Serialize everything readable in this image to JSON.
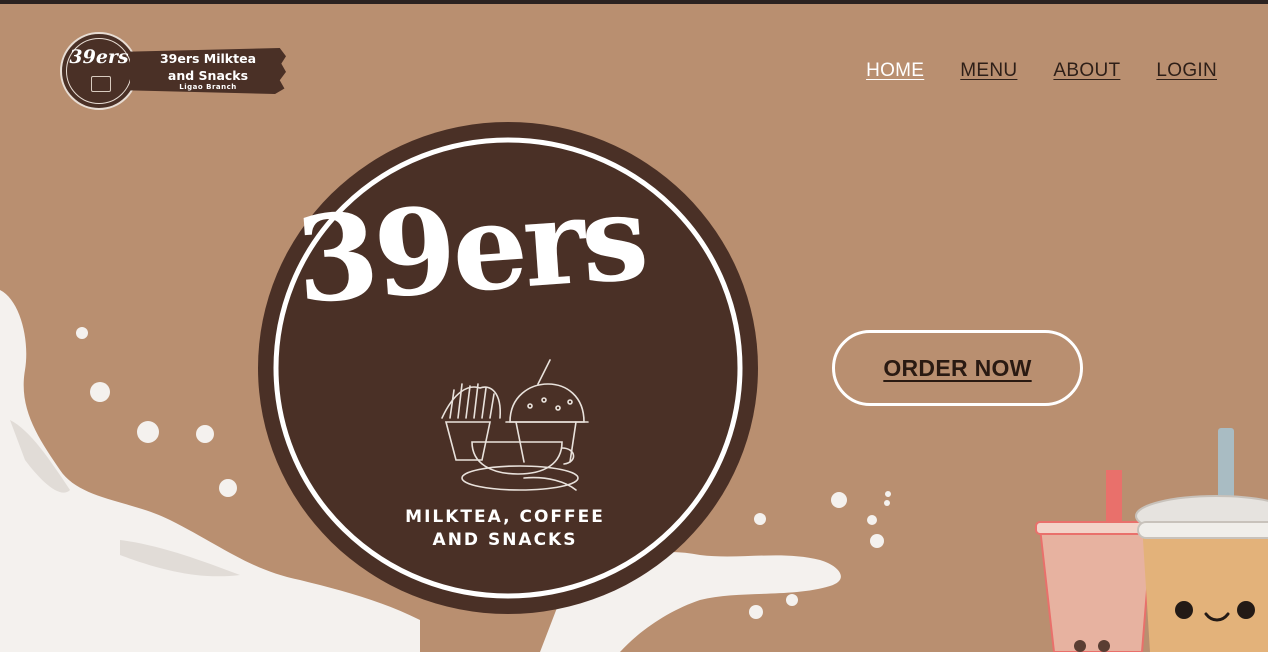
{
  "brand": {
    "emblem_text": "39ers",
    "line1": "39ers Milktea",
    "line2": "and Snacks",
    "line3": "Ligao Branch"
  },
  "nav": {
    "items": [
      {
        "label": "HOME",
        "active": true
      },
      {
        "label": "MENU",
        "active": false
      },
      {
        "label": "ABOUT",
        "active": false
      },
      {
        "label": "LOGIN",
        "active": false
      }
    ]
  },
  "hero": {
    "title": "39ers",
    "subtitle_line1": "MILKTEA, COFFEE",
    "subtitle_line2": "AND SNACKS",
    "order_button": "ORDER NOW"
  },
  "colors": {
    "background": "#b98f70",
    "brown": "#4a3026",
    "white": "#ffffff",
    "nav_text": "#2e1f18"
  },
  "icons": [
    "milk-splash-graphic",
    "fries-and-coffee-illustration",
    "boba-drinks-illustration"
  ]
}
